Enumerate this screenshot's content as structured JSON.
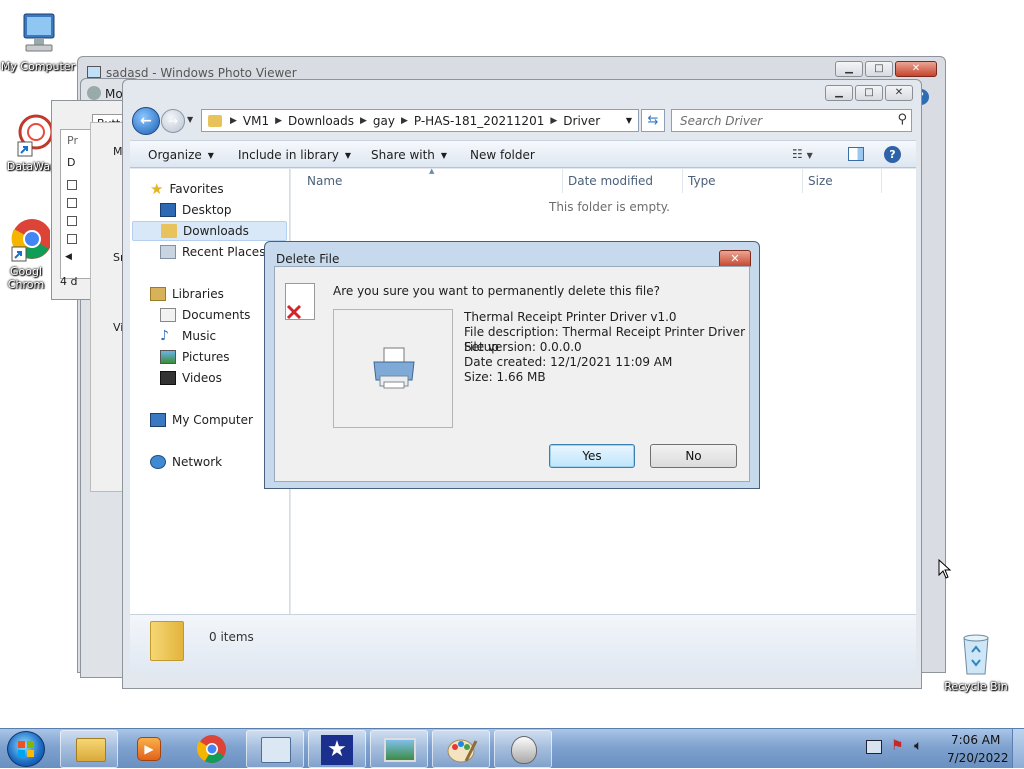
{
  "desktop": {
    "icons": [
      {
        "label": "My Computer"
      },
      {
        "label": "DataWag"
      },
      {
        "label": "Googl Chrom"
      },
      {
        "label": "Recycle Bin"
      }
    ]
  },
  "background_windows": {
    "photo_viewer_title": "sadasd - Windows Photo Viewer",
    "mo_title": "Mo",
    "button_label": "Butto",
    "left_labels": [
      "M",
      "Pr",
      "D",
      "Sr",
      "Vi"
    ],
    "status_fragment": "4 d"
  },
  "explorer": {
    "breadcrumb": [
      "VM1",
      "Downloads",
      "gay",
      "P-HAS-181_20211201",
      "Driver"
    ],
    "search_placeholder": "Search Driver",
    "toolbar": {
      "organize": "Organize",
      "include_in_library": "Include in library",
      "share_with": "Share with",
      "new_folder": "New folder"
    },
    "nav": {
      "favorites": "Favorites",
      "desktop": "Desktop",
      "downloads": "Downloads",
      "recent_places": "Recent Places",
      "libraries": "Libraries",
      "documents": "Documents",
      "music": "Music",
      "pictures": "Pictures",
      "videos": "Videos",
      "my_computer": "My Computer",
      "network": "Network"
    },
    "columns": {
      "name": "Name",
      "date_modified": "Date modified",
      "type": "Type",
      "size": "Size"
    },
    "empty_text": "This folder is empty.",
    "status_items": "0 items"
  },
  "dialog": {
    "title": "Delete File",
    "question": "Are you sure you want to permanently delete this file?",
    "file_name": "Thermal Receipt Printer Driver v1.0",
    "file_description": "File description: Thermal Receipt Printer Driver Setup",
    "file_version": "File version: 0.0.0.0",
    "date_created": "Date created: 12/1/2021 11:09 AM",
    "size": "Size: 1.66 MB",
    "yes_label": "Yes",
    "no_label": "No"
  },
  "taskbar": {
    "time": "7:06 AM",
    "date": "7/20/2022",
    "apps": [
      "explorer-icon",
      "media-player-icon",
      "chrome-icon",
      "control-panel-icon",
      "star-app-icon",
      "photo-viewer-icon",
      "paint-icon",
      "mouse-icon"
    ]
  },
  "colors": {
    "taskbar_top": "#a8c4e6",
    "taskbar_bottom": "#6d94c4",
    "accent_blue": "#3c7fb1",
    "close_red": "#c7452b"
  }
}
